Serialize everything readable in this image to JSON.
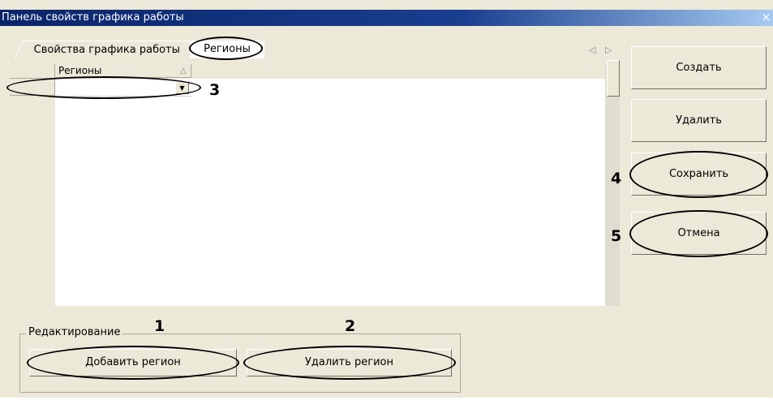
{
  "window": {
    "title": "Панель свойств графика работы",
    "close_icon": "close-icon"
  },
  "tabs": [
    {
      "label": "Свойства графика работы",
      "active": false
    },
    {
      "label": "Регионы",
      "active": true
    }
  ],
  "tab_scroll_icons": "◁ ▷",
  "grid": {
    "column_header": "Регионы",
    "sort_icon": "sort-ascending-icon",
    "rows": [
      {
        "value": ""
      }
    ],
    "dropdown_icon": "chevron-down-icon"
  },
  "actions": {
    "create": "Создать",
    "delete": "Удалить",
    "save": "Сохранить",
    "cancel": "Отмена"
  },
  "editing": {
    "group_label": "Редактирование",
    "add_region": "Добавить регион",
    "remove_region": "Удалить регион"
  },
  "callouts": {
    "n1": "1",
    "n2": "2",
    "n3": "3",
    "n4": "4",
    "n5": "5"
  }
}
